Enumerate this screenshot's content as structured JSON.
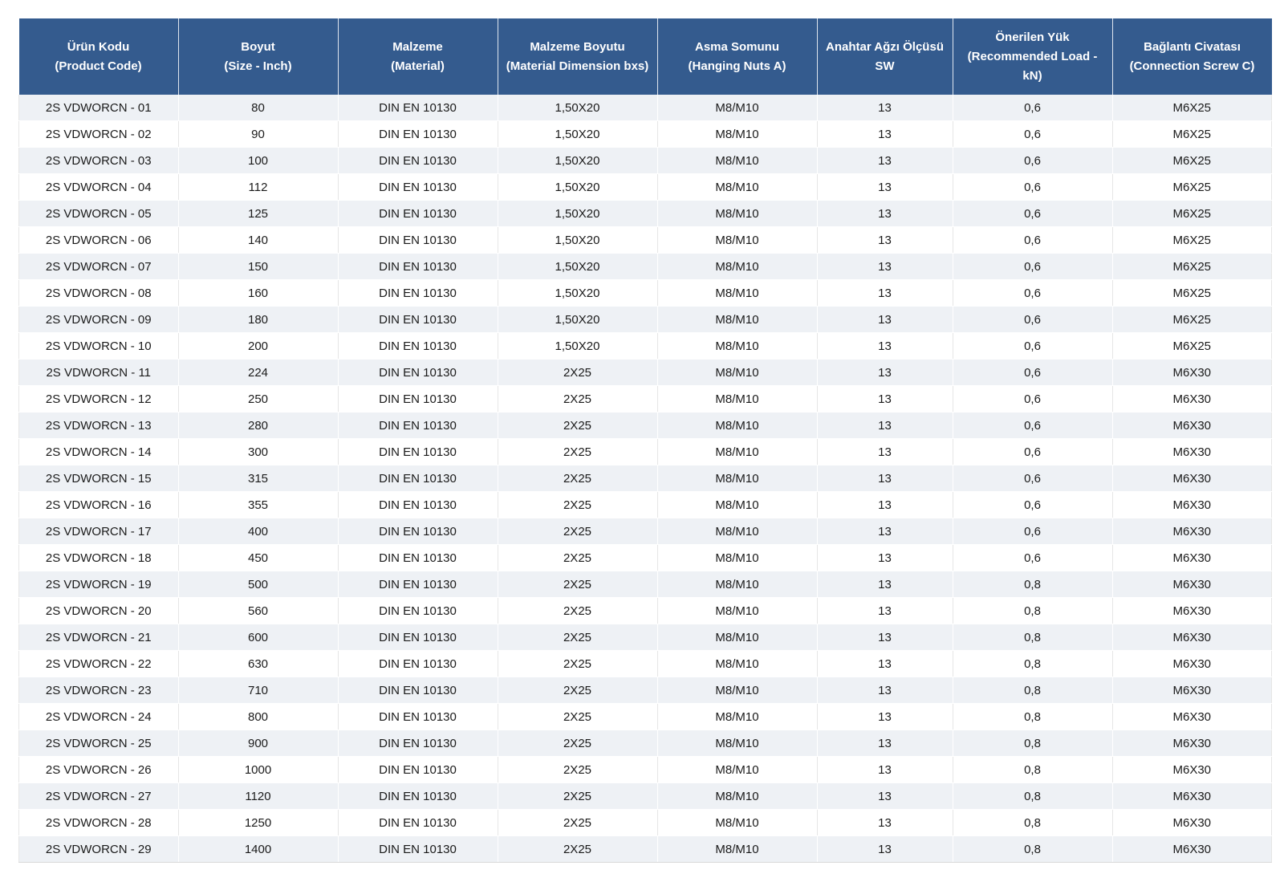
{
  "headers": [
    {
      "line1": "Ürün Kodu",
      "line2": "(Product Code)"
    },
    {
      "line1": "Boyut",
      "line2": "(Size - Inch)"
    },
    {
      "line1": "Malzeme",
      "line2": "(Material)"
    },
    {
      "line1": "Malzeme Boyutu",
      "line2": "(Material Dimension bxs)"
    },
    {
      "line1": "Asma Somunu",
      "line2": "(Hanging Nuts A)"
    },
    {
      "line1": "Anahtar Ağzı Ölçüsü",
      "line2": "SW"
    },
    {
      "line1": "Önerilen Yük",
      "line2": "(Recommended Load -",
      "line3": "kN)"
    },
    {
      "line1": "Bağlantı Civatası",
      "line2": "(Connection Screw C)"
    }
  ],
  "rows": [
    [
      "2S VDWORCN - 01",
      "80",
      "DIN EN 10130",
      "1,50X20",
      "M8/M10",
      "13",
      "0,6",
      "M6X25"
    ],
    [
      "2S VDWORCN - 02",
      "90",
      "DIN EN 10130",
      "1,50X20",
      "M8/M10",
      "13",
      "0,6",
      "M6X25"
    ],
    [
      "2S VDWORCN - 03",
      "100",
      "DIN EN 10130",
      "1,50X20",
      "M8/M10",
      "13",
      "0,6",
      "M6X25"
    ],
    [
      "2S VDWORCN - 04",
      "112",
      "DIN EN 10130",
      "1,50X20",
      "M8/M10",
      "13",
      "0,6",
      "M6X25"
    ],
    [
      "2S VDWORCN - 05",
      "125",
      "DIN EN 10130",
      "1,50X20",
      "M8/M10",
      "13",
      "0,6",
      "M6X25"
    ],
    [
      "2S VDWORCN - 06",
      "140",
      "DIN EN 10130",
      "1,50X20",
      "M8/M10",
      "13",
      "0,6",
      "M6X25"
    ],
    [
      "2S VDWORCN - 07",
      "150",
      "DIN EN 10130",
      "1,50X20",
      "M8/M10",
      "13",
      "0,6",
      "M6X25"
    ],
    [
      "2S VDWORCN - 08",
      "160",
      "DIN EN 10130",
      "1,50X20",
      "M8/M10",
      "13",
      "0,6",
      "M6X25"
    ],
    [
      "2S VDWORCN - 09",
      "180",
      "DIN EN 10130",
      "1,50X20",
      "M8/M10",
      "13",
      "0,6",
      "M6X25"
    ],
    [
      "2S VDWORCN - 10",
      "200",
      "DIN EN 10130",
      "1,50X20",
      "M8/M10",
      "13",
      "0,6",
      "M6X25"
    ],
    [
      "2S VDWORCN - 11",
      "224",
      "DIN EN 10130",
      "2X25",
      "M8/M10",
      "13",
      "0,6",
      "M6X30"
    ],
    [
      "2S VDWORCN - 12",
      "250",
      "DIN EN 10130",
      "2X25",
      "M8/M10",
      "13",
      "0,6",
      "M6X30"
    ],
    [
      "2S VDWORCN - 13",
      "280",
      "DIN EN 10130",
      "2X25",
      "M8/M10",
      "13",
      "0,6",
      "M6X30"
    ],
    [
      "2S VDWORCN - 14",
      "300",
      "DIN EN 10130",
      "2X25",
      "M8/M10",
      "13",
      "0,6",
      "M6X30"
    ],
    [
      "2S VDWORCN - 15",
      "315",
      "DIN EN 10130",
      "2X25",
      "M8/M10",
      "13",
      "0,6",
      "M6X30"
    ],
    [
      "2S VDWORCN - 16",
      "355",
      "DIN EN 10130",
      "2X25",
      "M8/M10",
      "13",
      "0,6",
      "M6X30"
    ],
    [
      "2S VDWORCN - 17",
      "400",
      "DIN EN 10130",
      "2X25",
      "M8/M10",
      "13",
      "0,6",
      "M6X30"
    ],
    [
      "2S VDWORCN - 18",
      "450",
      "DIN EN 10130",
      "2X25",
      "M8/M10",
      "13",
      "0,6",
      "M6X30"
    ],
    [
      "2S VDWORCN - 19",
      "500",
      "DIN EN 10130",
      "2X25",
      "M8/M10",
      "13",
      "0,8",
      "M6X30"
    ],
    [
      "2S VDWORCN - 20",
      "560",
      "DIN EN 10130",
      "2X25",
      "M8/M10",
      "13",
      "0,8",
      "M6X30"
    ],
    [
      "2S VDWORCN - 21",
      "600",
      "DIN EN 10130",
      "2X25",
      "M8/M10",
      "13",
      "0,8",
      "M6X30"
    ],
    [
      "2S VDWORCN - 22",
      "630",
      "DIN EN 10130",
      "2X25",
      "M8/M10",
      "13",
      "0,8",
      "M6X30"
    ],
    [
      "2S VDWORCN - 23",
      "710",
      "DIN EN 10130",
      "2X25",
      "M8/M10",
      "13",
      "0,8",
      "M6X30"
    ],
    [
      "2S VDWORCN - 24",
      "800",
      "DIN EN 10130",
      "2X25",
      "M8/M10",
      "13",
      "0,8",
      "M6X30"
    ],
    [
      "2S VDWORCN - 25",
      "900",
      "DIN EN 10130",
      "2X25",
      "M8/M10",
      "13",
      "0,8",
      "M6X30"
    ],
    [
      "2S VDWORCN - 26",
      "1000",
      "DIN EN 10130",
      "2X25",
      "M8/M10",
      "13",
      "0,8",
      "M6X30"
    ],
    [
      "2S VDWORCN - 27",
      "1120",
      "DIN EN 10130",
      "2X25",
      "M8/M10",
      "13",
      "0,8",
      "M6X30"
    ],
    [
      "2S VDWORCN - 28",
      "1250",
      "DIN EN 10130",
      "2X25",
      "M8/M10",
      "13",
      "0,8",
      "M6X30"
    ],
    [
      "2S VDWORCN - 29",
      "1400",
      "DIN EN 10130",
      "2X25",
      "M8/M10",
      "13",
      "0,8",
      "M6X30"
    ]
  ],
  "colors": {
    "header_bg": "#345b8e",
    "header_text": "#ffffff",
    "row_alt_bg": "#eef1f5"
  }
}
